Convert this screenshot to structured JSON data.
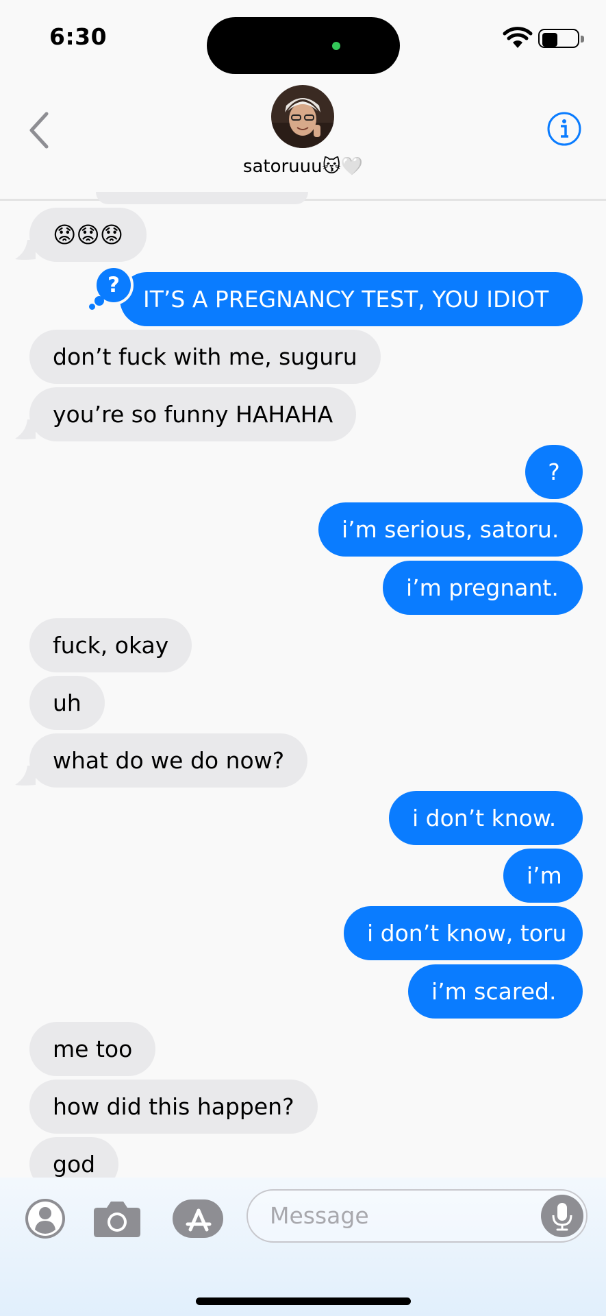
{
  "status": {
    "time": "6:30"
  },
  "header": {
    "contact_name": "satoruuu😽🤍"
  },
  "messages": [
    {
      "text": "😟😟😟",
      "side": "received"
    },
    {
      "text": "IT’S A PREGNANCY TEST, YOU IDIOT",
      "side": "sent",
      "reaction": "?"
    },
    {
      "text": "don’t fuck with me, suguru",
      "side": "received"
    },
    {
      "text": "you’re so funny HAHAHA",
      "side": "received"
    },
    {
      "text": "?",
      "side": "sent"
    },
    {
      "text": "i’m serious, satoru.",
      "side": "sent"
    },
    {
      "text": "i’m pregnant.",
      "side": "sent"
    },
    {
      "text": "fuck, okay",
      "side": "received"
    },
    {
      "text": "uh",
      "side": "received"
    },
    {
      "text": "what do we do now?",
      "side": "received"
    },
    {
      "text": "i don’t know.",
      "side": "sent"
    },
    {
      "text": "i’m",
      "side": "sent"
    },
    {
      "text": "i don’t know, toru",
      "side": "sent"
    },
    {
      "text": "i’m scared.",
      "side": "sent"
    },
    {
      "text": "me too",
      "side": "received"
    },
    {
      "text": "how did this happen?",
      "side": "received"
    },
    {
      "text": "god",
      "side": "received"
    }
  ],
  "input": {
    "placeholder": "Message"
  },
  "colors": {
    "sent_bubble": "#0a7cff",
    "received_bubble": "#e9e9eb",
    "accent": "#0a7cff"
  }
}
